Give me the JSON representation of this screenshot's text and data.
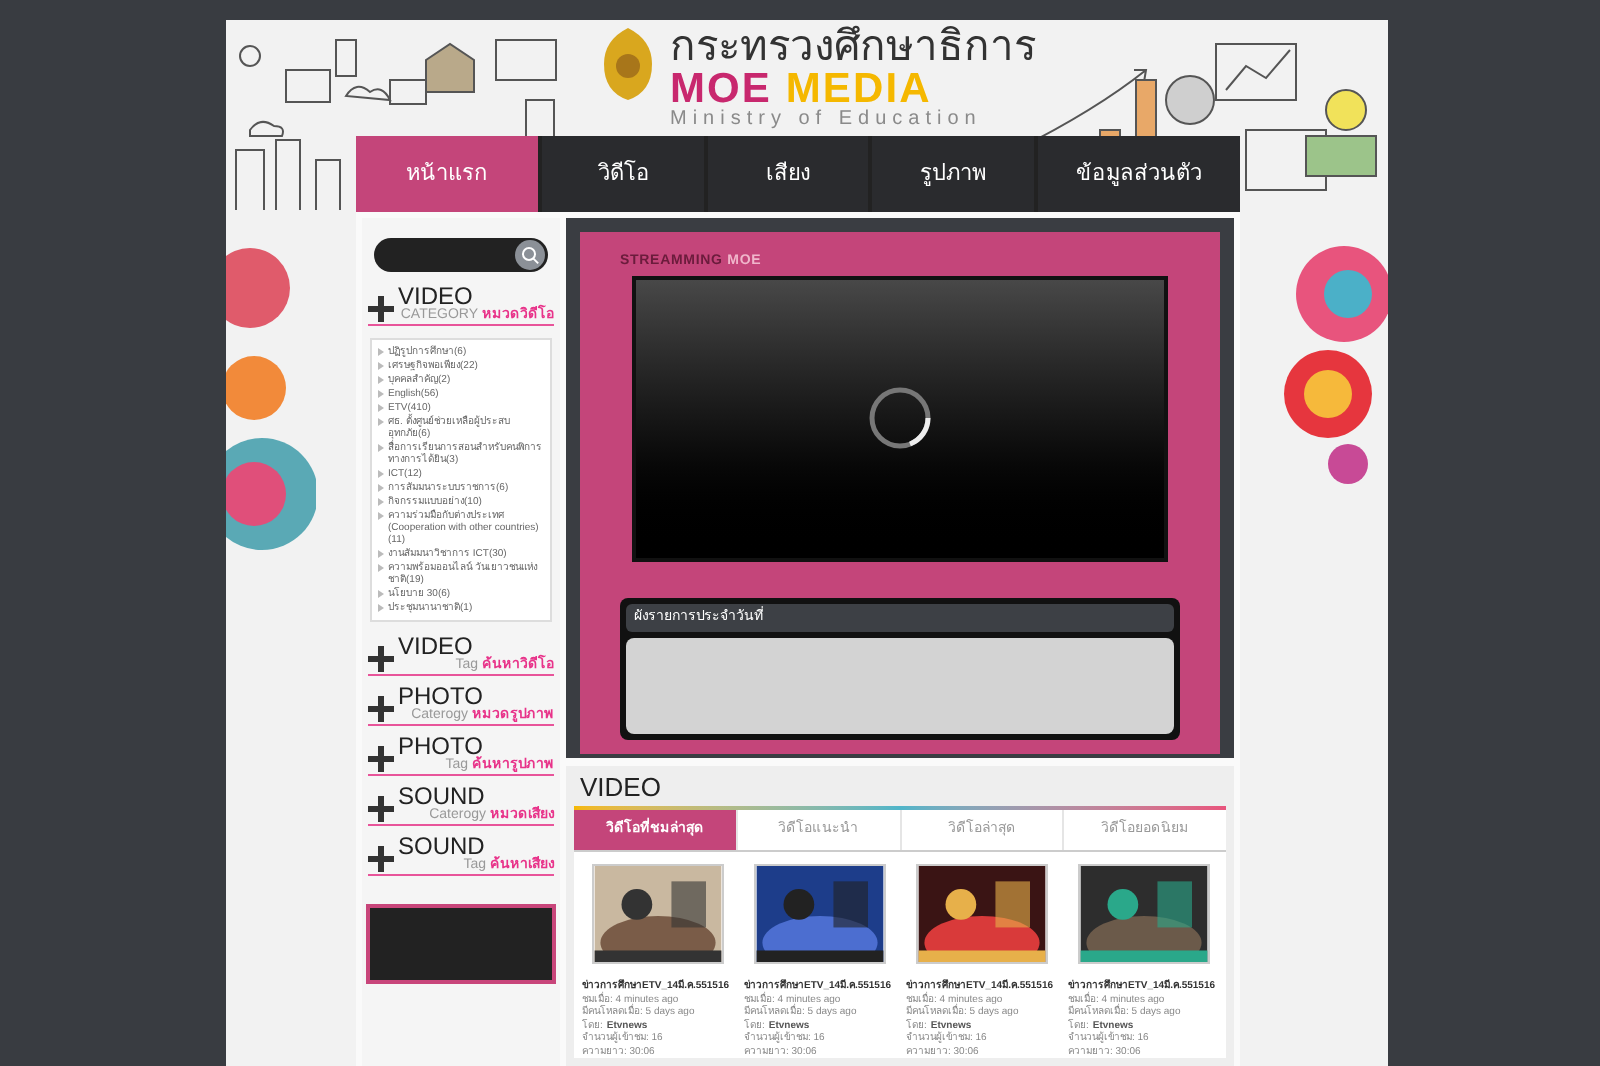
{
  "logo": {
    "title": "กระทรวงศึกษาธิการ",
    "brand_a": "MOE",
    "brand_b": "MEDIA",
    "subtitle": "Ministry of Education"
  },
  "nav": [
    {
      "label": "หน้าแรก",
      "selected": true
    },
    {
      "label": "วิดีโอ",
      "selected": false
    },
    {
      "label": "เสียง",
      "selected": false
    },
    {
      "label": "รูปภาพ",
      "selected": false
    },
    {
      "label": "ข้อมูลส่วนตัว",
      "selected": false
    }
  ],
  "sidebar": {
    "video_category": {
      "title": "VIDEO",
      "sub": "CATEGORY",
      "link": "หมวดวิดีโอ",
      "items": [
        "ปฏิรูปการศึกษา(6)",
        "เศรษฐกิจพอเพียง(22)",
        "บุคคลสำคัญ(2)",
        "English(56)",
        "ETV(410)",
        "ศธ. ตั้งศูนย์ช่วยเหลือผู้ประสบอุทกภัย(6)",
        "สื่อการเรียนการสอนสำหรับคนพิการทางการได้ยิน(3)",
        "ICT(12)",
        "การสัมมนาระบบราชการ(6)",
        "กิจกรรมแบบอย่าง(10)",
        "ความร่วมมือกับต่างประเทศ (Cooperation with other countries) (11)",
        "งานสัมมนาวิชาการ ICT(30)",
        "ความพร้อมออนไลน์ วันเยาวชนแห่งชาติ(19)",
        "นโยบาย 30(6)",
        "ประชุมนานาชาติ(1)"
      ]
    },
    "sections": [
      {
        "title": "VIDEO",
        "sub": "Tag",
        "link": "ค้นหาวิดีโอ"
      },
      {
        "title": "PHOTO",
        "sub": "Caterogy",
        "link": "หมวดรูปภาพ"
      },
      {
        "title": "PHOTO",
        "sub": "Tag",
        "link": "ค้นหารูปภาพ"
      },
      {
        "title": "SOUND",
        "sub": "Caterogy",
        "link": "หมวดเสียง"
      },
      {
        "title": "SOUND",
        "sub": "Tag",
        "link": "ค้นหาเสียง"
      }
    ]
  },
  "streaming": {
    "label_a": "STREAMMING",
    "label_b": "MOE",
    "schedule_title": "ผังรายการประจำวันที่"
  },
  "video": {
    "heading": "VIDEO",
    "tabs": [
      {
        "label": "วิดีโอที่ชมล่าสุด",
        "selected": true
      },
      {
        "label": "วิดีโอแนะนำ",
        "selected": false
      },
      {
        "label": "วิดีโอล่าสุด",
        "selected": false
      },
      {
        "label": "วิดีโอยอดนิยม",
        "selected": false
      }
    ],
    "items": [
      {
        "title": "ข่าวการศึกษาETV_14มี.ค.551516",
        "viewed": "ชมเมื่อ: 4 minutes ago",
        "uploaded": "มีคนโหลดเมื่อ: 5 days ago",
        "by_label": "โดย:",
        "by": "Etvnews",
        "views": "จำนวนผู้เข้าชม: 16",
        "length": "ความยาว: 30:06"
      },
      {
        "title": "ข่าวการศึกษาETV_14มี.ค.551516",
        "viewed": "ชมเมื่อ: 4 minutes ago",
        "uploaded": "มีคนโหลดเมื่อ: 5 days ago",
        "by_label": "โดย:",
        "by": "Etvnews",
        "views": "จำนวนผู้เข้าชม: 16",
        "length": "ความยาว: 30:06"
      },
      {
        "title": "ข่าวการศึกษาETV_14มี.ค.551516",
        "viewed": "ชมเมื่อ: 4 minutes ago",
        "uploaded": "มีคนโหลดเมื่อ: 5 days ago",
        "by_label": "โดย:",
        "by": "Etvnews",
        "views": "จำนวนผู้เข้าชม: 16",
        "length": "ความยาว: 30:06"
      },
      {
        "title": "ข่าวการศึกษาETV_14มี.ค.551516",
        "viewed": "ชมเมื่อ: 4 minutes ago",
        "uploaded": "มีคนโหลดเมื่อ: 5 days ago",
        "by_label": "โดย:",
        "by": "Etvnews",
        "views": "จำนวนผู้เข้าชม: 16",
        "length": "ความยาว: 30:06"
      }
    ]
  }
}
